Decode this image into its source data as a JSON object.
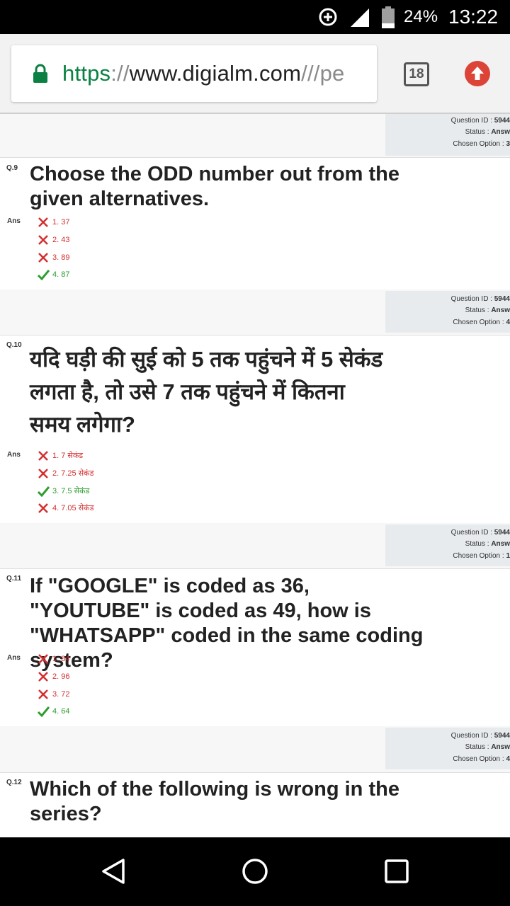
{
  "status_bar": {
    "battery_percent": "24%",
    "time": "13:22"
  },
  "browser": {
    "url_scheme": "https",
    "url_separator": "://",
    "url_host": "www.digialm.com",
    "url_rest": "///pe",
    "tab_count": "18"
  },
  "info_labels": {
    "question_id": "Question ID :",
    "status": "Status :",
    "chosen": "Chosen Option :"
  },
  "info_blocks": [
    {
      "question_id": "5944",
      "status": "Answ",
      "chosen": "3"
    },
    {
      "question_id": "5944",
      "status": "Answ",
      "chosen": "4"
    },
    {
      "question_id": "5944",
      "status": "Answ",
      "chosen": "1"
    },
    {
      "question_id": "5944",
      "status": "Answ",
      "chosen": "4"
    }
  ],
  "ans_label": "Ans",
  "questions": [
    {
      "number": "Q.9",
      "text": "Choose the ODD number out from the given alternatives.",
      "options": [
        {
          "text": "1. 37",
          "correct": false
        },
        {
          "text": "2. 43",
          "correct": false
        },
        {
          "text": "3. 89",
          "correct": false
        },
        {
          "text": "4. 87",
          "correct": true
        }
      ]
    },
    {
      "number": "Q.10",
      "text": "यदि घड़ी की सुई को 5 तक पहुंचने में 5 सेकंड लगता है, तो उसे 7 तक पहुंचने में कितना समय लगेगा?",
      "options": [
        {
          "text": "1. 7 सेकंड",
          "correct": false
        },
        {
          "text": "2. 7.25 सेकंड",
          "correct": false
        },
        {
          "text": "3. 7.5 सेकंड",
          "correct": true
        },
        {
          "text": "4. 7.05 सेकंड",
          "correct": false
        }
      ]
    },
    {
      "number": "Q.11",
      "text": "If \"GOOGLE\" is coded as 36, \"YOUTUBE\" is coded as 49, how is \"WHATSAPP\" coded in the same coding system?",
      "options": [
        {
          "text": "1. 84",
          "correct": false
        },
        {
          "text": "2. 96",
          "correct": false
        },
        {
          "text": "3. 72",
          "correct": false
        },
        {
          "text": "4. 64",
          "correct": true
        }
      ]
    },
    {
      "number": "Q.12",
      "text": "Which of the following is wrong in the series?",
      "options": []
    }
  ]
}
